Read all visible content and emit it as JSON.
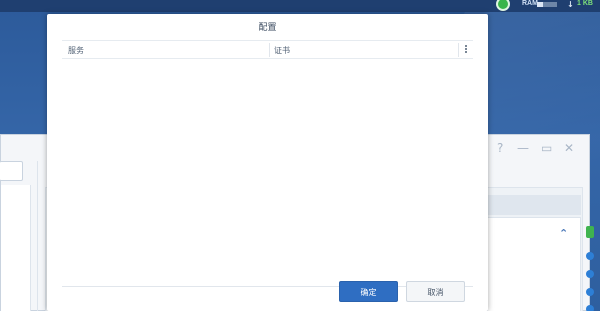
{
  "topbar": {
    "ram_label": "RAM",
    "ram_usage_fraction": 0.3,
    "network_speed": "1 KB"
  },
  "dialog": {
    "title": "配置",
    "columns": [
      "服务",
      "证书"
    ],
    "rows": [],
    "ok_label": "确定",
    "cancel_label": "取消"
  },
  "colors": {
    "primary": "#2f6ec2",
    "desktop": "#2f5d9e",
    "status_ok": "#39b54a"
  }
}
